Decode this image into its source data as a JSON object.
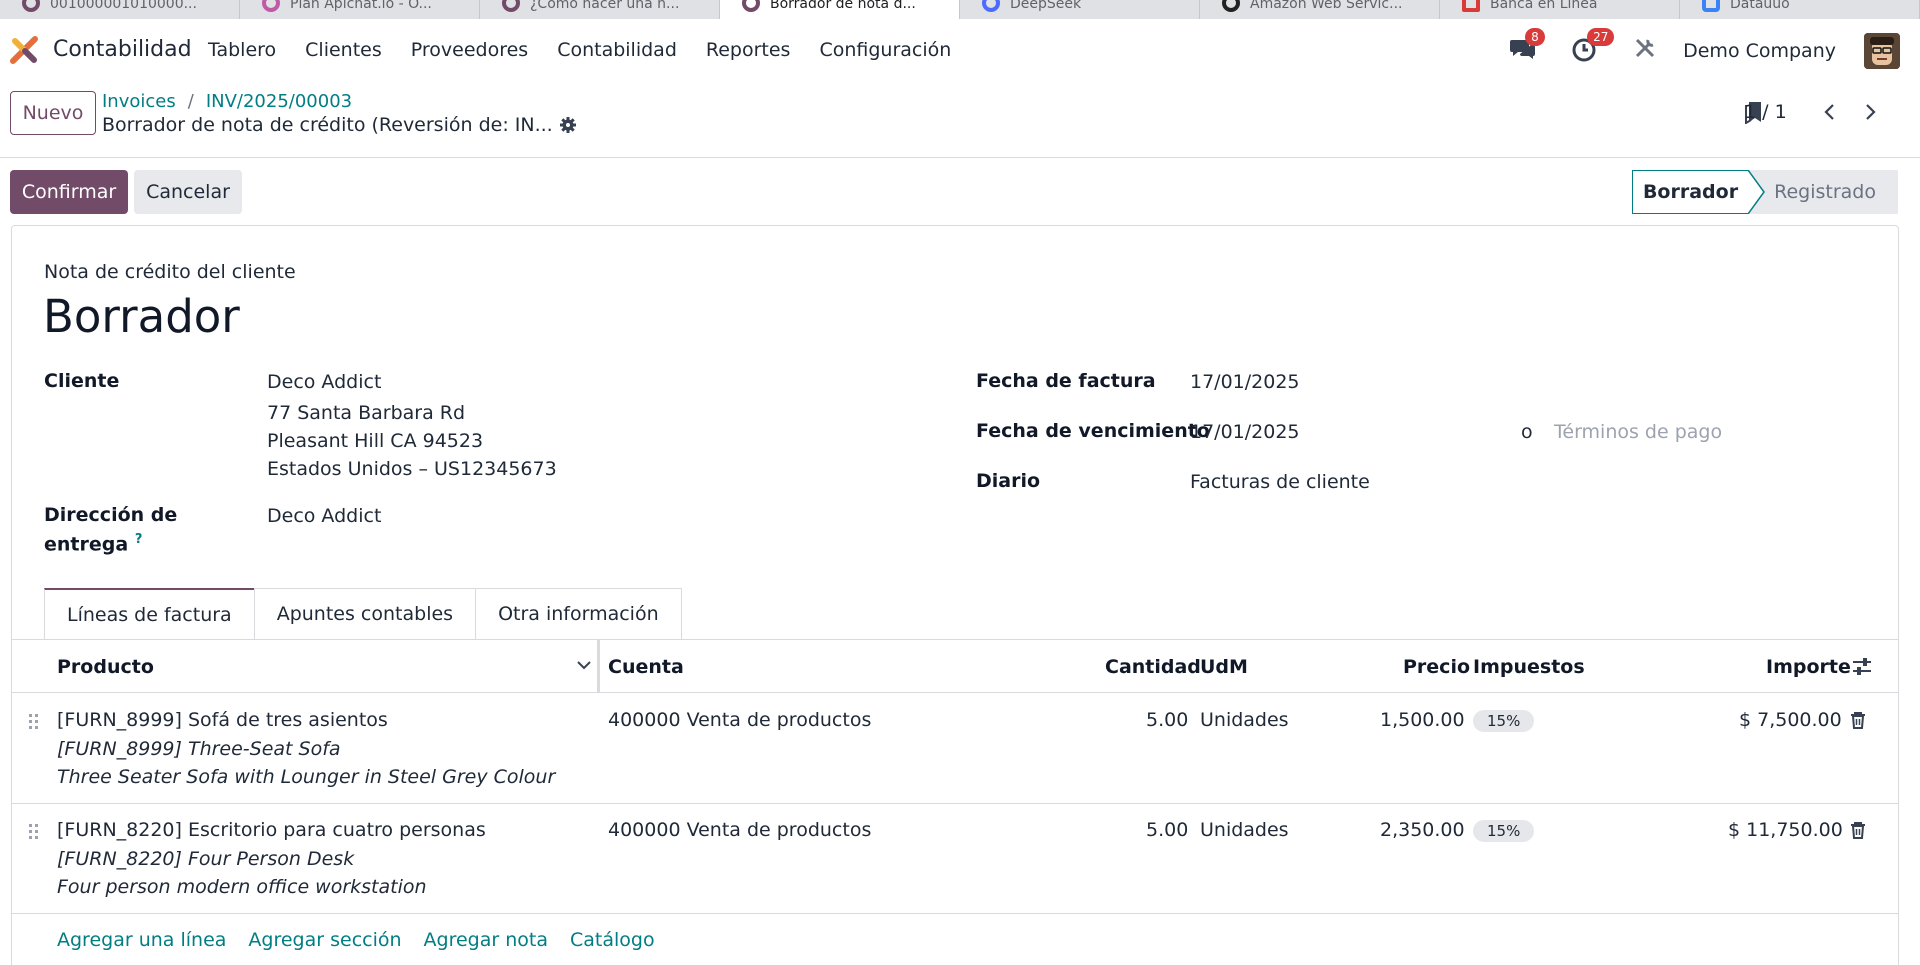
{
  "browser_tabs": [
    {
      "title": "001000001010000...",
      "active": false
    },
    {
      "title": "Plan Apichat.io - O...",
      "active": false
    },
    {
      "title": "¿Cómo hacer una n...",
      "active": false
    },
    {
      "title": "Borrador de nota d...",
      "active": true
    },
    {
      "title": "DeepSeek",
      "active": false
    },
    {
      "title": "Amazon Web Servic...",
      "active": false
    },
    {
      "title": "Banca en Línea",
      "active": false
    },
    {
      "title": "Datauuo",
      "active": false
    }
  ],
  "app": {
    "name": "Contabilidad",
    "menu": [
      "Tablero",
      "Clientes",
      "Proveedores",
      "Contabilidad",
      "Reportes",
      "Configuración"
    ],
    "messages_badge": "8",
    "activities_badge": "27",
    "company": "Demo Company"
  },
  "control": {
    "new_label": "Nuevo",
    "breadcrumb": [
      "Invoices",
      "INV/2025/00003"
    ],
    "subtitle": "Borrador de nota de crédito (Reversión de: IN...",
    "pager": "1 / 1"
  },
  "actions": {
    "confirm": "Confirmar",
    "cancel": "Cancelar",
    "status": [
      "Borrador",
      "Registrado"
    ]
  },
  "form": {
    "doc_kind": "Nota de crédito del cliente",
    "title": "Borrador",
    "customer_label": "Cliente",
    "customer_name": "Deco Addict",
    "customer_addr1": "77 Santa Barbara Rd",
    "customer_addr2": "Pleasant Hill CA 94523",
    "customer_addr3": "Estados Unidos – US12345673",
    "delivery_label_1": "Dirección de",
    "delivery_label_2": "entrega",
    "delivery_help": "?",
    "delivery_value": "Deco Addict",
    "invoice_date_label": "Fecha de factura",
    "invoice_date": "17/01/2025",
    "due_date_label": "Fecha de vencimiento",
    "due_date": "17/01/2025",
    "or_label": "o",
    "payment_terms_placeholder": "Términos de pago",
    "journal_label": "Diario",
    "journal": "Facturas de cliente"
  },
  "tabs": [
    "Líneas de factura",
    "Apuntes contables",
    "Otra información"
  ],
  "table": {
    "headers": {
      "product": "Producto",
      "account": "Cuenta",
      "qty": "Cantidad",
      "uom": "UdM",
      "price": "Precio",
      "taxes": "Impuestos",
      "amount": "Importe"
    },
    "rows": [
      {
        "product": "[FURN_8999] Sofá de tres asientos",
        "desc1": "[FURN_8999] Three-Seat Sofa",
        "desc2": "Three Seater Sofa with Lounger in Steel Grey Colour",
        "account": "400000 Venta de productos",
        "qty": "5.00",
        "uom": "Unidades",
        "price": "1,500.00",
        "tax": "15%",
        "amount": "$ 7,500.00"
      },
      {
        "product": "[FURN_8220] Escritorio para cuatro personas",
        "desc1": "[FURN_8220] Four Person Desk",
        "desc2": "Four person modern office workstation",
        "account": "400000 Venta de productos",
        "qty": "5.00",
        "uom": "Unidades",
        "price": "2,350.00",
        "tax": "15%",
        "amount": "$ 11,750.00"
      }
    ],
    "add_links": [
      "Agregar una línea",
      "Agregar sección",
      "Agregar nota",
      "Catálogo"
    ]
  },
  "colors": {
    "brand": "#714b67",
    "link": "#017e84",
    "badge": "#d93a3a"
  }
}
